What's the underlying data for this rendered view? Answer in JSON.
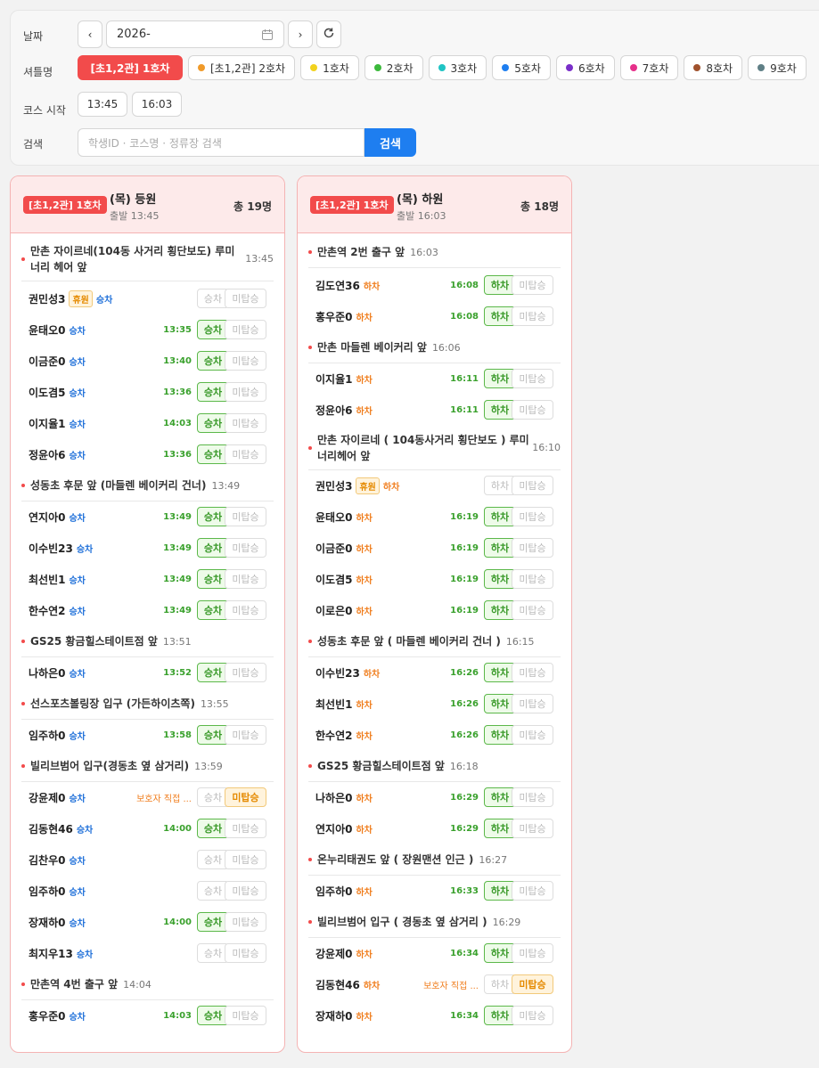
{
  "filters": {
    "date_label": "날짜",
    "date_value": "2026-",
    "prev": "‹",
    "next": "›",
    "shuttle_label": "셔틀명",
    "shuttles": [
      {
        "label": "[초1,2관] 1호차",
        "color": "",
        "active": true
      },
      {
        "label": "[초1,2관] 2호차",
        "color": "#f09a2a"
      },
      {
        "label": "1호차",
        "color": "#f2d21e"
      },
      {
        "label": "2호차",
        "color": "#3cb93c"
      },
      {
        "label": "3호차",
        "color": "#1fc4c4"
      },
      {
        "label": "5호차",
        "color": "#1e7ef0"
      },
      {
        "label": "6호차",
        "color": "#7a2fc9"
      },
      {
        "label": "7호차",
        "color": "#e6308a"
      },
      {
        "label": "8호차",
        "color": "#a0522d"
      },
      {
        "label": "9호차",
        "color": "#5f7f86"
      }
    ],
    "course_label": "코스 시작",
    "course_times": [
      "13:45",
      "16:03"
    ],
    "search_label": "검색",
    "search_placeholder": "학생ID · 코스명 · 정류장 검색",
    "search_button": "검색"
  },
  "cards": [
    {
      "badge": "[초1,2관] 1호차",
      "title": "(목) 등원",
      "sub": "출발 13:45",
      "total": "총 19명",
      "btn1": "승차",
      "btn2": "미탑승",
      "stops": [
        {
          "name": "만촌 자이르네(104동 사거리 횡단보도) 루미너리 헤어 앞",
          "time": "13:45",
          "two": true,
          "rows": [
            {
              "name": "권민성3",
              "leave": "휴원",
              "status": "승차",
              "time": "",
              "b1": false
            },
            {
              "name": "윤태오0",
              "status": "승차",
              "time": "13:35",
              "b1": true
            },
            {
              "name": "이금준0",
              "status": "승차",
              "time": "13:40",
              "b1": true
            },
            {
              "name": "이도겸5",
              "status": "승차",
              "time": "13:36",
              "b1": true
            },
            {
              "name": "이지율1",
              "status": "승차",
              "time": "14:03",
              "b1": true
            },
            {
              "name": "정윤아6",
              "status": "승차",
              "time": "13:36",
              "b1": true
            }
          ]
        },
        {
          "name": "성동초 후문 앞 (마들렌 베이커리 건너)",
          "time": "13:49",
          "rows": [
            {
              "name": "연지아0",
              "status": "승차",
              "time": "13:49",
              "b1": true
            },
            {
              "name": "이수빈23",
              "status": "승차",
              "time": "13:49",
              "b1": true
            },
            {
              "name": "최선빈1",
              "status": "승차",
              "time": "13:49",
              "b1": true
            },
            {
              "name": "한수연2",
              "status": "승차",
              "time": "13:49",
              "b1": true
            }
          ]
        },
        {
          "name": "GS25 황금힐스테이트점 앞",
          "time": "13:51",
          "rows": [
            {
              "name": "나하은0",
              "status": "승차",
              "time": "13:52",
              "b1": true
            }
          ]
        },
        {
          "name": "선스포츠볼링장 입구 (가든하이츠쪽)",
          "time": "13:55",
          "rows": [
            {
              "name": "임주하0",
              "status": "승차",
              "time": "13:58",
              "b1": true
            }
          ]
        },
        {
          "name": "빌리브범어 입구(경동초 옆 삼거리)",
          "time": "13:59",
          "rows": [
            {
              "name": "강윤제0",
              "status": "승차",
              "note": "보호자 직접 ...",
              "b1": false,
              "b2": true
            },
            {
              "name": "김동현46",
              "status": "승차",
              "time": "14:00",
              "b1": true
            },
            {
              "name": "김찬우0",
              "status": "승차",
              "time": "",
              "b1": false
            },
            {
              "name": "임주하0",
              "status": "승차",
              "time": "",
              "b1": false
            },
            {
              "name": "장재하0",
              "status": "승차",
              "time": "14:00",
              "b1": true
            },
            {
              "name": "최지우13",
              "status": "승차",
              "time": "",
              "b1": false
            }
          ]
        },
        {
          "name": "만촌역 4번 출구 앞",
          "time": "14:04",
          "rows": [
            {
              "name": "홍우준0",
              "status": "승차",
              "time": "14:03",
              "b1": true
            }
          ]
        }
      ]
    },
    {
      "badge": "[초1,2관] 1호차",
      "title": "(목) 하원",
      "sub": "출발 16:03",
      "total": "총 18명",
      "btn1": "하차",
      "btn2": "미탑승",
      "stops": [
        {
          "name": "만촌역 2번 출구 앞",
          "time": "16:03",
          "rows": [
            {
              "name": "김도연36",
              "status": "하차",
              "time": "16:08",
              "b1": true
            },
            {
              "name": "홍우준0",
              "status": "하차",
              "time": "16:08",
              "b1": true
            }
          ]
        },
        {
          "name": "만촌 마들렌 베이커리 앞",
          "time": "16:06",
          "rows": [
            {
              "name": "이지율1",
              "status": "하차",
              "time": "16:11",
              "b1": true
            },
            {
              "name": "정윤아6",
              "status": "하차",
              "time": "16:11",
              "b1": true
            }
          ]
        },
        {
          "name": "만촌 자이르네 ( 104동사거리 횡단보도 ) 루미너리헤어 앞",
          "time": "16:10",
          "two": true,
          "rows": [
            {
              "name": "권민성3",
              "leave": "휴원",
              "status": "하차",
              "time": "",
              "b1": false
            },
            {
              "name": "윤태오0",
              "status": "하차",
              "time": "16:19",
              "b1": true
            },
            {
              "name": "이금준0",
              "status": "하차",
              "time": "16:19",
              "b1": true
            },
            {
              "name": "이도겸5",
              "status": "하차",
              "time": "16:19",
              "b1": true
            },
            {
              "name": "이로은0",
              "status": "하차",
              "time": "16:19",
              "b1": true
            }
          ]
        },
        {
          "name": "성동초 후문 앞 ( 마들렌 베이커리 건너 )",
          "time": "16:15",
          "rows": [
            {
              "name": "이수빈23",
              "status": "하차",
              "time": "16:26",
              "b1": true
            },
            {
              "name": "최선빈1",
              "status": "하차",
              "time": "16:26",
              "b1": true
            },
            {
              "name": "한수연2",
              "status": "하차",
              "time": "16:26",
              "b1": true
            }
          ]
        },
        {
          "name": "GS25 황금힐스테이트점 앞",
          "time": "16:18",
          "rows": [
            {
              "name": "나하은0",
              "status": "하차",
              "time": "16:29",
              "b1": true
            },
            {
              "name": "연지아0",
              "status": "하차",
              "time": "16:29",
              "b1": true
            }
          ]
        },
        {
          "name": "온누리태권도 앞 ( 장원맨션 인근 )",
          "time": "16:27",
          "rows": [
            {
              "name": "임주하0",
              "status": "하차",
              "time": "16:33",
              "b1": true
            }
          ]
        },
        {
          "name": "빌리브범어 입구 ( 경동초 옆 삼거리 )",
          "time": "16:29",
          "rows": [
            {
              "name": "강윤제0",
              "status": "하차",
              "time": "16:34",
              "b1": true
            },
            {
              "name": "김동현46",
              "status": "하차",
              "note": "보호자 직접 ...",
              "b1": false,
              "b2": true
            },
            {
              "name": "장재하0",
              "status": "하차",
              "time": "16:34",
              "b1": true
            }
          ]
        }
      ]
    }
  ]
}
